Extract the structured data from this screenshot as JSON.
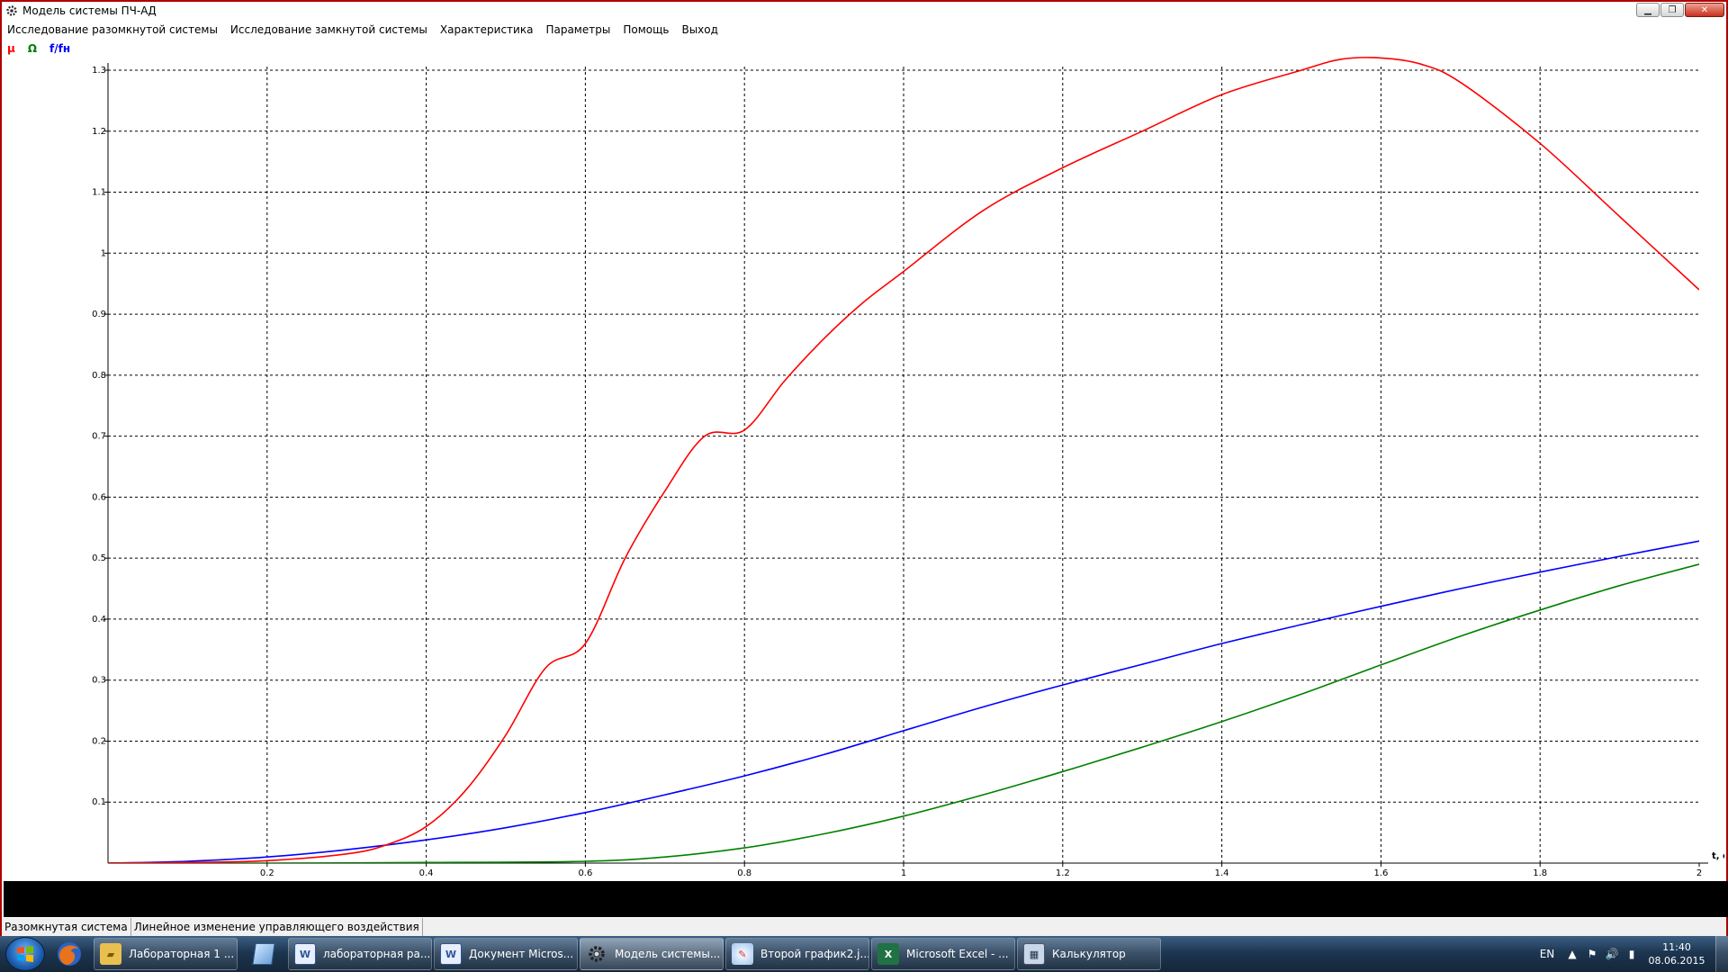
{
  "window": {
    "title": "Модель системы ПЧ-АД",
    "icon": "gear-icon"
  },
  "menu": {
    "items": [
      {
        "label": "Исследование разомкнутой системы"
      },
      {
        "label": "Исследование замкнутой системы"
      },
      {
        "label": "Характеристика"
      },
      {
        "label": "Параметры"
      },
      {
        "label": "Помощь"
      },
      {
        "label": "Выход"
      }
    ]
  },
  "legend": [
    {
      "label": "μ",
      "color": "#ff0000"
    },
    {
      "label": "Ω",
      "color": "#008000"
    },
    {
      "label": "f/fн",
      "color": "#0000ff"
    }
  ],
  "chart_data": {
    "type": "line",
    "xlabel": "t, c",
    "ylabel": "",
    "xlim": [
      0,
      2
    ],
    "ylim": [
      0,
      1.3
    ],
    "grid": true,
    "x_ticks": [
      "0.2",
      "0.4",
      "0.6",
      "0.8",
      "1",
      "1.2",
      "1.4",
      "1.6",
      "1.8",
      "2"
    ],
    "y_ticks": [
      "0.1",
      "0.2",
      "0.3",
      "0.4",
      "0.5",
      "0.6",
      "0.7",
      "0.8",
      "0.9",
      "1",
      "1.1",
      "1.2",
      "1.3"
    ],
    "series": [
      {
        "color": "#ff0000",
        "x": [
          0,
          0.1,
          0.2,
          0.3,
          0.35,
          0.4,
          0.45,
          0.5,
          0.55,
          0.6,
          0.65,
          0.7,
          0.75,
          0.8,
          0.85,
          0.9,
          0.95,
          1.0,
          1.1,
          1.2,
          1.3,
          1.4,
          1.5,
          1.55,
          1.6,
          1.65,
          1.7,
          1.8,
          1.9,
          2.0
        ],
        "y": [
          0,
          0.001,
          0.004,
          0.015,
          0.03,
          0.06,
          0.12,
          0.21,
          0.32,
          0.36,
          0.5,
          0.61,
          0.7,
          0.71,
          0.79,
          0.86,
          0.92,
          0.97,
          1.07,
          1.14,
          1.2,
          1.26,
          1.3,
          1.318,
          1.32,
          1.31,
          1.28,
          1.18,
          1.06,
          0.94
        ]
      },
      {
        "color": "#008000",
        "x": [
          0,
          0.2,
          0.4,
          0.6,
          0.7,
          0.8,
          0.9,
          1.0,
          1.1,
          1.2,
          1.3,
          1.4,
          1.5,
          1.6,
          1.7,
          1.8,
          1.9,
          2.0
        ],
        "y": [
          0,
          0,
          0.001,
          0.003,
          0.01,
          0.025,
          0.048,
          0.077,
          0.112,
          0.15,
          0.19,
          0.232,
          0.277,
          0.325,
          0.372,
          0.415,
          0.455,
          0.49
        ]
      },
      {
        "color": "#0000ff",
        "x": [
          0,
          0.1,
          0.2,
          0.3,
          0.4,
          0.5,
          0.6,
          0.7,
          0.8,
          0.9,
          1.0,
          1.1,
          1.2,
          1.3,
          1.4,
          1.5,
          1.6,
          1.7,
          1.8,
          1.9,
          2.0
        ],
        "y": [
          0,
          0.003,
          0.01,
          0.022,
          0.038,
          0.058,
          0.083,
          0.112,
          0.143,
          0.178,
          0.217,
          0.256,
          0.292,
          0.326,
          0.36,
          0.391,
          0.421,
          0.45,
          0.477,
          0.503,
          0.528
        ]
      }
    ]
  },
  "status": {
    "mode": "Разомкнутая система",
    "description": "Линейное изменение управляющего воздействия"
  },
  "taskbar": {
    "pinned": [
      {
        "icon": "firefox-icon"
      },
      {
        "icon": "explorer-icon"
      }
    ],
    "tasks": [
      {
        "label": "Лабораторная 1 ...",
        "icon": "folder-icon",
        "active": false
      },
      {
        "label": "",
        "icon": "notepad-icon",
        "active": false
      },
      {
        "label": "лабораторная ра...",
        "icon": "word-icon",
        "active": false
      },
      {
        "label": "Документ Micros...",
        "icon": "word-icon",
        "active": false
      },
      {
        "label": "Модель системы...",
        "icon": "gear-icon",
        "active": true
      },
      {
        "label": "Второй график2.j...",
        "icon": "paint-icon",
        "active": false
      },
      {
        "label": "Microsoft Excel - ...",
        "icon": "excel-icon",
        "active": false
      },
      {
        "label": "Калькулятор",
        "icon": "calculator-icon",
        "active": false
      }
    ],
    "tray": {
      "language": "EN",
      "time": "11:40",
      "date": "08.06.2015"
    }
  }
}
